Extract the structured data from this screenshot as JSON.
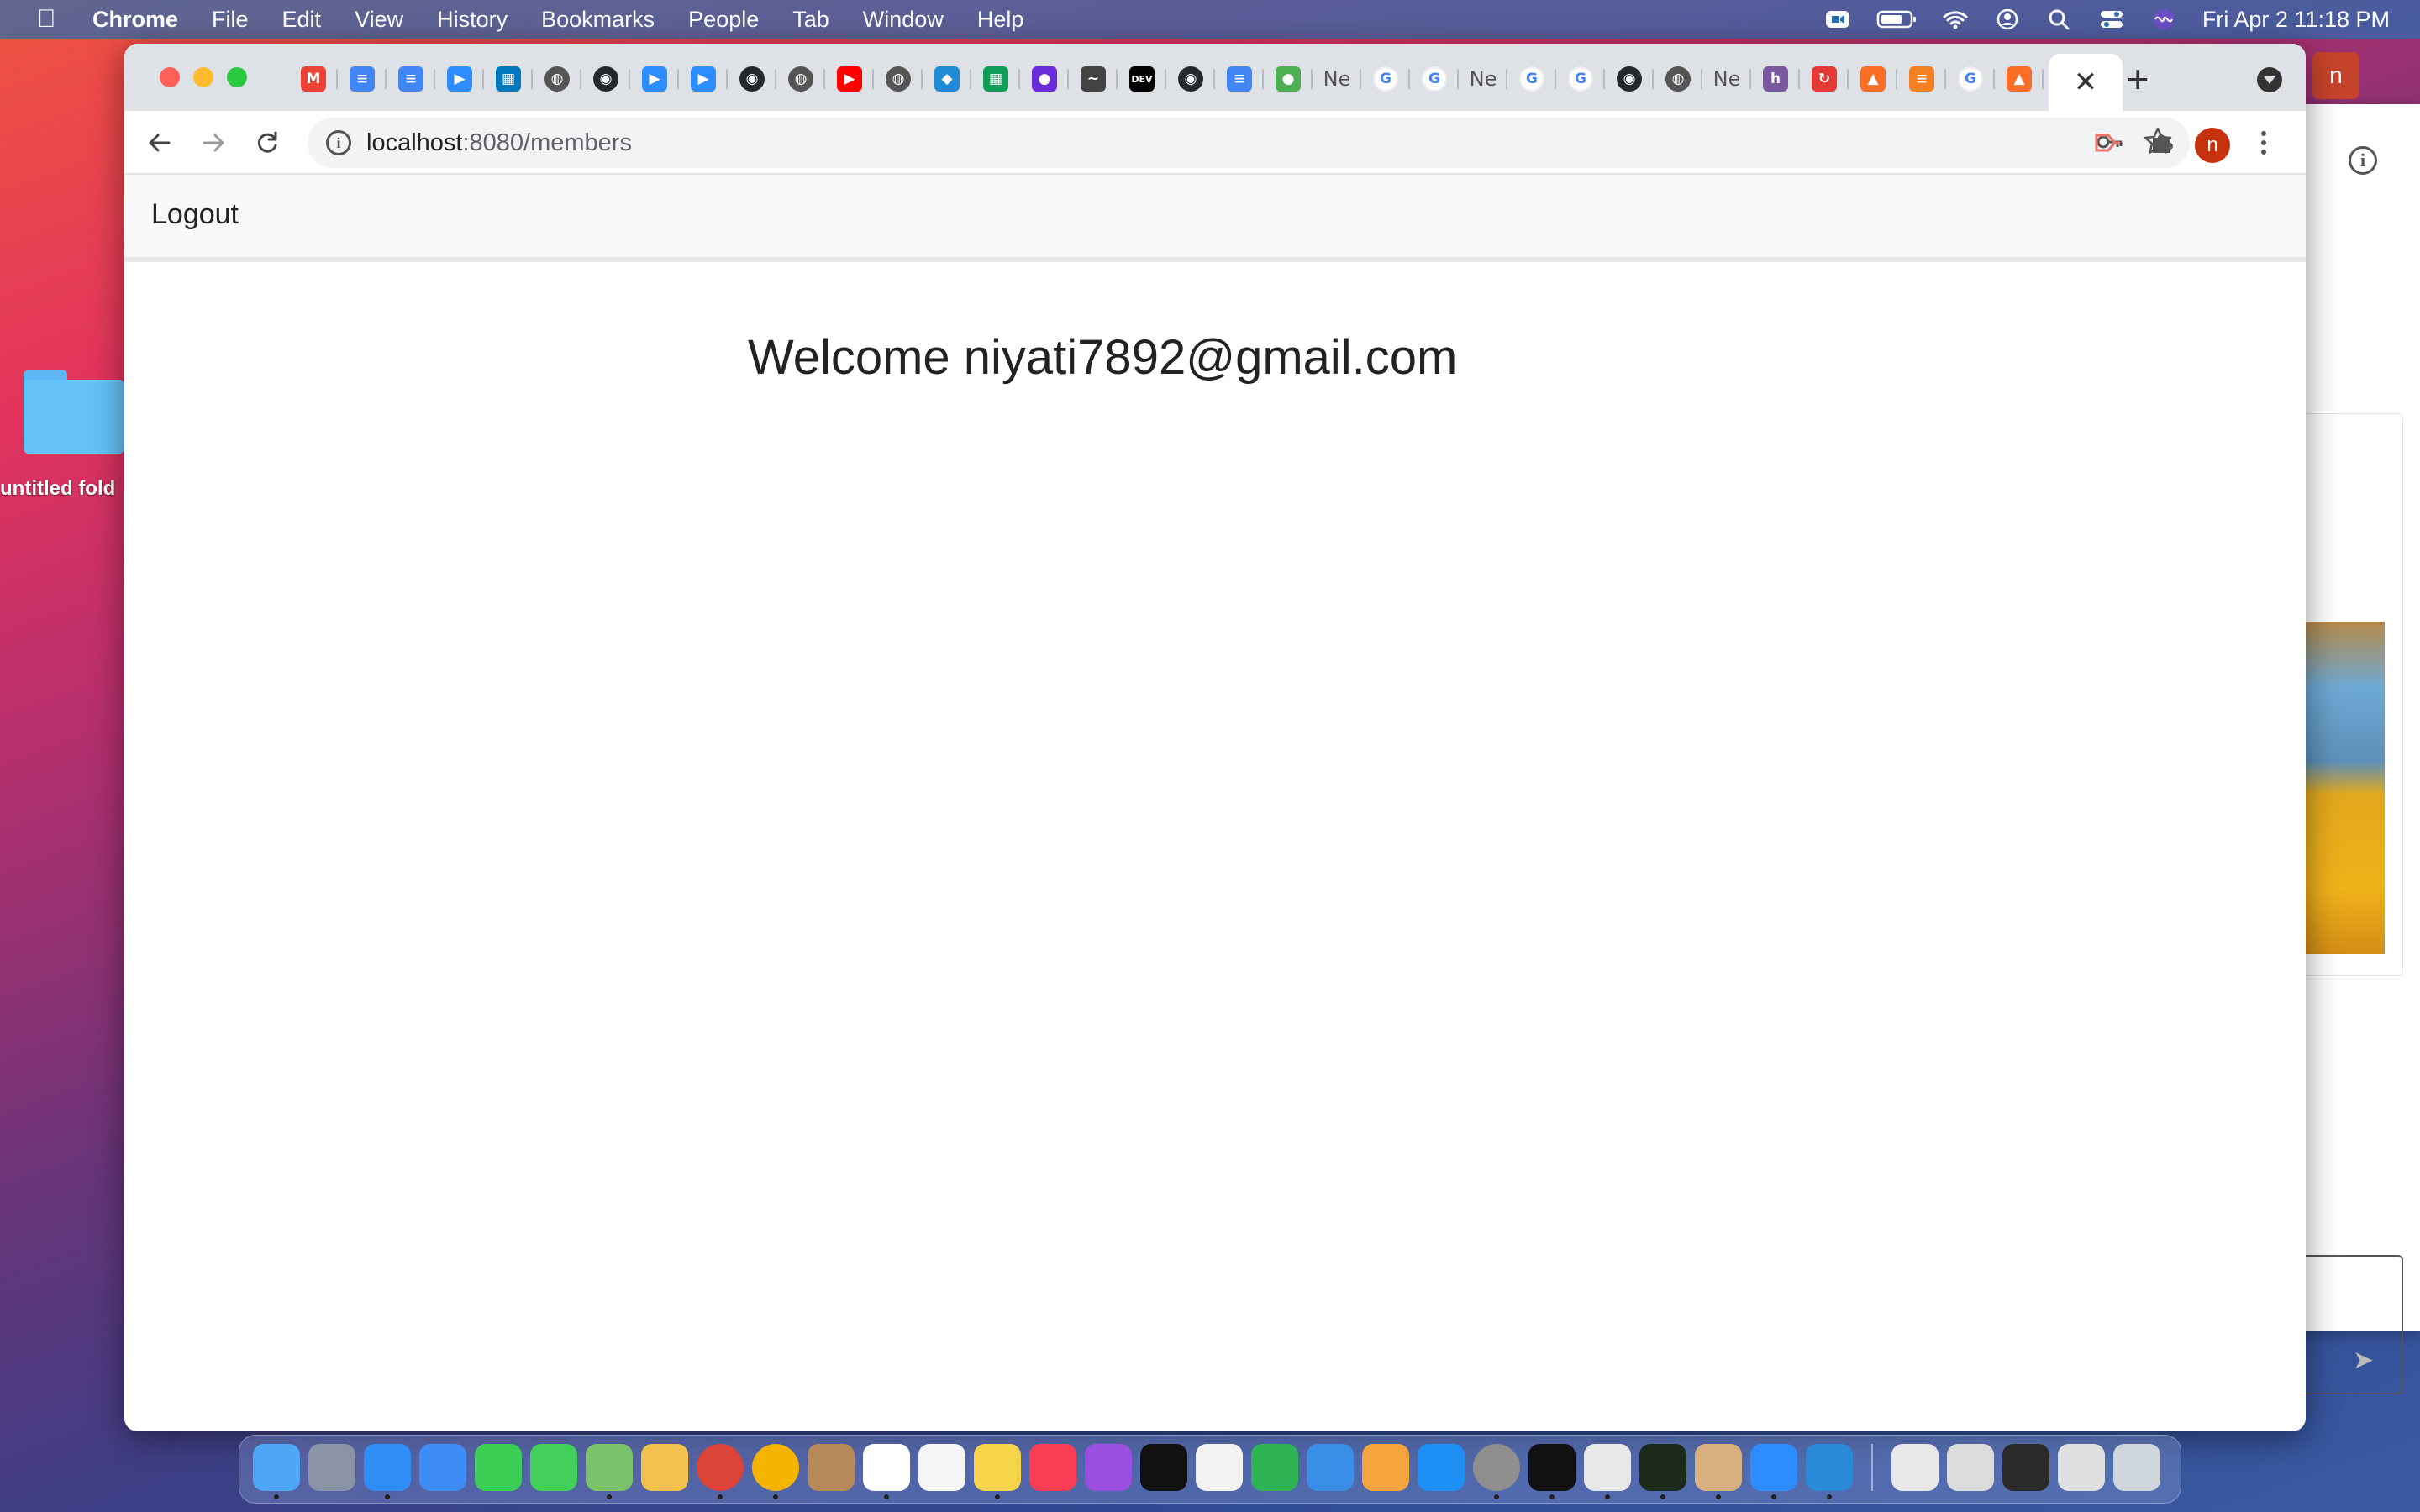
{
  "menubar": {
    "app_name": "Chrome",
    "items": [
      "File",
      "Edit",
      "View",
      "History",
      "Bookmarks",
      "People",
      "Tab",
      "Window",
      "Help"
    ],
    "clock": "Fri Apr 2  11:18 PM"
  },
  "desktop": {
    "folder_label": "untitled fold"
  },
  "browser": {
    "tabs": [
      {
        "icon": "gmail-icon",
        "glyph": "M",
        "color": "#ea4335"
      },
      {
        "icon": "google-docs-icon",
        "glyph": "≡",
        "color": "#4285f4"
      },
      {
        "icon": "google-docs-icon",
        "glyph": "≡",
        "color": "#4285f4"
      },
      {
        "icon": "zoom-icon",
        "glyph": "▶",
        "color": "#2d8cff"
      },
      {
        "icon": "trello-icon",
        "glyph": "▦",
        "color": "#0079bf"
      },
      {
        "icon": "globe-icon",
        "glyph": "◍",
        "color": "#555555"
      },
      {
        "icon": "github-icon",
        "glyph": "◉",
        "color": "#24292e"
      },
      {
        "icon": "zoom-icon",
        "glyph": "▶",
        "color": "#2d8cff"
      },
      {
        "icon": "zoom-icon",
        "glyph": "▶",
        "color": "#2d8cff"
      },
      {
        "icon": "github-icon",
        "glyph": "◉",
        "color": "#24292e"
      },
      {
        "icon": "globe-icon",
        "glyph": "◍",
        "color": "#555555"
      },
      {
        "icon": "youtube-icon",
        "glyph": "▶",
        "color": "#ff0000"
      },
      {
        "icon": "globe-icon",
        "glyph": "◍",
        "color": "#555555"
      },
      {
        "icon": "cube-icon",
        "glyph": "◆",
        "color": "#1f8ad6"
      },
      {
        "icon": "sheets-icon",
        "glyph": "▦",
        "color": "#0f9d58"
      },
      {
        "icon": "butterfly-icon",
        "glyph": "●",
        "color": "#6a2bd8"
      },
      {
        "icon": "mustache-icon",
        "glyph": "~",
        "color": "#444444"
      },
      {
        "icon": "dev-icon",
        "glyph": "DEV",
        "color": "#000000"
      },
      {
        "icon": "github-icon",
        "glyph": "◉",
        "color": "#24292e"
      },
      {
        "icon": "google-docs-icon",
        "glyph": "≡",
        "color": "#4285f4"
      },
      {
        "icon": "mongodb-leaf-icon",
        "glyph": "●",
        "color": "#4caf50"
      },
      {
        "icon": "netflix-text-icon",
        "glyph": "Ne",
        "color": "transparent"
      },
      {
        "icon": "google-icon",
        "glyph": "G",
        "color": "#4285f4"
      },
      {
        "icon": "google-icon",
        "glyph": "G",
        "color": "#4285f4"
      },
      {
        "icon": "netflix-text-icon",
        "glyph": "Ne",
        "color": "transparent"
      },
      {
        "icon": "google-icon",
        "glyph": "G",
        "color": "#4285f4"
      },
      {
        "icon": "google-icon",
        "glyph": "G",
        "color": "#4285f4"
      },
      {
        "icon": "github-icon",
        "glyph": "◉",
        "color": "#24292e"
      },
      {
        "icon": "globe-icon",
        "glyph": "◍",
        "color": "#555555"
      },
      {
        "icon": "netflix-text-icon",
        "glyph": "Ne",
        "color": "transparent"
      },
      {
        "icon": "heroku-icon",
        "glyph": "h",
        "color": "#79589f"
      },
      {
        "icon": "refresh-red-icon",
        "glyph": "↻",
        "color": "#e53935"
      },
      {
        "icon": "gitlab-icon",
        "glyph": "▲",
        "color": "#fc6d26"
      },
      {
        "icon": "stackoverflow-icon",
        "glyph": "≡",
        "color": "#f48024"
      },
      {
        "icon": "google-icon",
        "glyph": "G",
        "color": "#4285f4"
      },
      {
        "icon": "gitlab-icon",
        "glyph": "▲",
        "color": "#fc6d26"
      }
    ],
    "url_host": "localhost",
    "url_path": ":8080/members",
    "profile_initial": "n"
  },
  "page": {
    "logout_label": "Logout",
    "welcome_text": "Welcome niyati7892@gmail.com"
  },
  "back_window": {
    "avatar_initial": "n"
  },
  "dock": {
    "apps": [
      {
        "name": "finder-icon",
        "color": "#4fa6f5",
        "running": true
      },
      {
        "name": "launchpad-icon",
        "color": "#8a94a6",
        "running": false
      },
      {
        "name": "safari-icon",
        "color": "#2f8ef4",
        "running": true
      },
      {
        "name": "mail-icon",
        "color": "#3d8df5",
        "running": false
      },
      {
        "name": "facetime-icon",
        "color": "#3ccf55",
        "running": false
      },
      {
        "name": "messages-icon",
        "color": "#42d05a",
        "running": false
      },
      {
        "name": "maps-icon",
        "color": "#7ac36a",
        "running": true
      },
      {
        "name": "photos-icon",
        "color": "#f2c14e",
        "running": false
      },
      {
        "name": "chrome-icon",
        "color": "#db4437",
        "running": true
      },
      {
        "name": "chrome-icon",
        "color": "#f4b400",
        "running": true
      },
      {
        "name": "contacts-icon",
        "color": "#b88a5a",
        "running": false
      },
      {
        "name": "calendar-icon",
        "color": "#ffffff",
        "running": true
      },
      {
        "name": "reminders-icon",
        "color": "#f5f5f5",
        "running": false
      },
      {
        "name": "notes-icon",
        "color": "#f7d54a",
        "running": true
      },
      {
        "name": "music-icon",
        "color": "#fa3c55",
        "running": false
      },
      {
        "name": "podcasts-icon",
        "color": "#9b4fe0",
        "running": false
      },
      {
        "name": "tv-icon",
        "color": "#111111",
        "running": false
      },
      {
        "name": "news-icon",
        "color": "#f2f2f2",
        "running": false
      },
      {
        "name": "numbers-icon",
        "color": "#2fb455",
        "running": false
      },
      {
        "name": "keynote-icon",
        "color": "#3a8ee8",
        "running": false
      },
      {
        "name": "pages-icon",
        "color": "#f6a53c",
        "running": false
      },
      {
        "name": "app-store-icon",
        "color": "#1e8ff5",
        "running": false
      },
      {
        "name": "system-preferences-icon",
        "color": "#8f8f8f",
        "running": true
      },
      {
        "name": "terminal-icon",
        "color": "#111111",
        "running": true
      },
      {
        "name": "slack-icon",
        "color": "#e8e8e8",
        "running": true
      },
      {
        "name": "activity-monitor-icon",
        "color": "#1b2a1b",
        "running": true
      },
      {
        "name": "paint-icon",
        "color": "#d8b080",
        "running": true
      },
      {
        "name": "zoom-app-icon",
        "color": "#2d8cff",
        "running": true
      },
      {
        "name": "vscode-icon",
        "color": "#2a8ad8",
        "running": true
      }
    ],
    "recent": [
      {
        "name": "recent-window-thumbnail",
        "color": "#e8e8e8"
      },
      {
        "name": "recent-window-thumbnail",
        "color": "#dcdcdc"
      },
      {
        "name": "recent-window-thumbnail",
        "color": "#2a2a2a"
      },
      {
        "name": "recent-window-thumbnail",
        "color": "#e0e0e0"
      },
      {
        "name": "trash-icon",
        "color": "#cfd6dc"
      }
    ]
  }
}
